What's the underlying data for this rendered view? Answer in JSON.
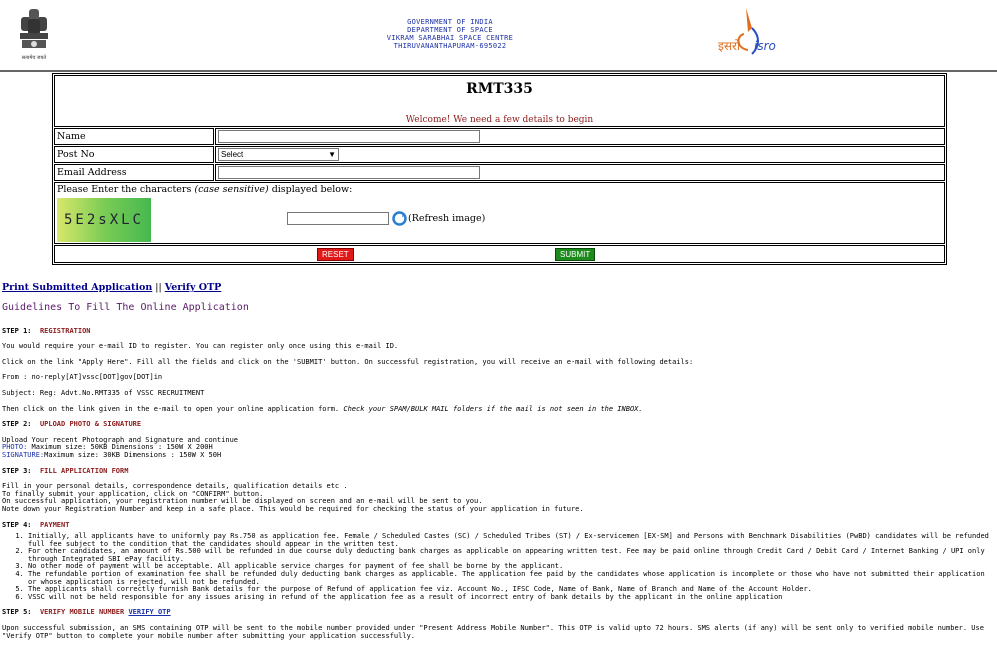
{
  "header": {
    "line1": "GOVERNMENT OF INDIA",
    "line2": "DEPARTMENT OF SPACE",
    "line3": "VIKRAM SARABHAI SPACE CENTRE",
    "line4": "THIRUVANANTHAPURAM-695022",
    "emblem_caption": "सत्यमेव जयते",
    "isro_logo_text_hi": "इसरो",
    "isro_logo_text_en": "isro"
  },
  "form": {
    "title": "RMT335",
    "welcome": "Welcome! We need a few details to begin",
    "name_label": "Name",
    "post_label": "Post No",
    "post_selected": "Select",
    "email_label": "Email Address",
    "captcha_prompt_pre": "Please Enter the characters ",
    "captcha_prompt_em": "(case sensitive)",
    "captcha_prompt_post": " displayed below:",
    "captcha_text": "5E2sXLC",
    "refresh_label": "(Refresh image)",
    "reset_label": "RESET",
    "submit_label": "SUBMIT"
  },
  "links": {
    "print": "Print Submitted Application",
    "sep": " || ",
    "verify": "Verify OTP"
  },
  "guidelines": {
    "title": "Guidelines To Fill The Online Application",
    "step1": {
      "num": "STEP 1:",
      "title": "REGISTRATION"
    },
    "s1p1": "You would require your e-mail ID to register. You can register only once using this e-mail ID.",
    "s1p2": "Click on the link \"Apply Here\". Fill all the fields and click on the 'SUBMIT'  button. On successful registration, you will receive an e-mail with following details:",
    "s1p3": "From : no-reply[AT]vssc[DOT]gov[DOT]in",
    "s1p4": "Subject: Reg: Advt.No.RMT335 of VSSC RECRUITMENT",
    "s1p5a": "Then click on the link given in the e-mail to open your online application form. ",
    "s1p5b": "Check your SPAM/BULK MAIL folders if the mail is not seen in the INBOX.",
    "step2": {
      "num": "STEP 2:",
      "title": "UPLOAD PHOTO & SIGNATURE"
    },
    "s2p1": "Upload Your recent Photograph and Signature and continue",
    "s2p2a": "PHOTO:",
    "s2p2b": " Maximum size: 50KB Dimensions : 150W X 200H",
    "s2p3a": "SIGNATURE:",
    "s2p3b": "Maximum size: 30KB Dimensions : 150W X 50H",
    "step3": {
      "num": "STEP 3:",
      "title": "FILL APPLICATION FORM"
    },
    "s3p1": "Fill in your personal details, correspondence details, qualification details etc .",
    "s3p2": "To finally submit your application, click on \"CONFIRM\" button.",
    "s3p3": "On successful application, your registration number will be displayed on screen and an e-mail will be sent to you.",
    "s3p4": "Note down your Registration Number and keep in a safe place. This would be required for checking the status of your application in future.",
    "step4": {
      "num": "STEP 4:",
      "title": "PAYMENT"
    },
    "s4items": [
      "Initially, all applicants have to uniformly pay Rs.750 as application fee. Female / Scheduled Castes (SC) / Scheduled Tribes (ST) / Ex-servicemen [EX-SM] and Persons with Benchmark Disabilities (PwBD) candidates will be refunded full fee subject to the condition that the candidates should appear in the written test.",
      "For other candidates, an amount of Rs.500 will be refunded in due course duly deducting bank charges as applicable on appearing written test. Fee may be paid online through Credit Card / Debit Card / Internet Banking / UPI only through Integrated SBI ePay facility.",
      "No other mode of payment will be acceptable. All applicable service charges for payment of fee shall be borne by the applicant.",
      "The refundable portion of examination fee shall be refunded duly deducting bank charges as applicable. The application fee paid by the candidates whose application is incomplete or those who have not submitted their application or whose application is rejected, will not be refunded.",
      "The applicants shall correctly furnish Bank details for the purpose of Refund of application fee viz. Account No., IFSC Code, Name of Bank, Name of Branch and Name of the Account Holder.",
      "VSSC will not be held responsible for any issues arising in refund of the application fee as a result of incorrect entry of bank details by the applicant in the online application"
    ],
    "step5": {
      "num": "STEP 5:",
      "title": "VERIFY MOBILE NUMBER",
      "link": "VERIFY OTP"
    },
    "s5p1": "Upon successful submission, an SMS containing OTP will be sent to the mobile number provided under \"Present Address Mobile Number\". This OTP is valid upto 72 hours. SMS alerts (if any) will be sent only to verified mobile number. Use \"Verify OTP\" button to complete your mobile number after submitting your application successfully."
  },
  "colors": {
    "header_blue": "#1a2fa8",
    "step_red": "#8b1c1c",
    "title_purple": "#5a1a6b",
    "reset_red": "#e01818",
    "submit_green": "#1d8a1d"
  }
}
